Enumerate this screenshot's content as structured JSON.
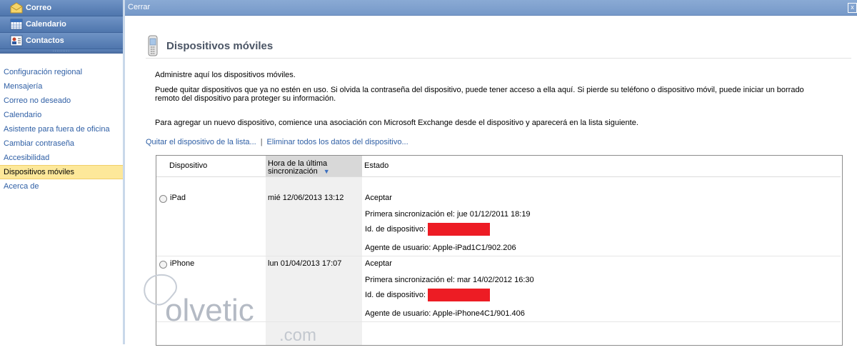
{
  "nav": {
    "mail": "Correo",
    "calendar": "Calendario",
    "contacts": "Contactos"
  },
  "options": {
    "items": [
      "Configuración regional",
      "Mensajería",
      "Correo no deseado",
      "Calendario",
      "Asistente para fuera de oficina",
      "Cambiar contraseña",
      "Accesibilidad",
      "Dispositivos móviles",
      "Acerca de"
    ],
    "selected_index": 7
  },
  "topbar": {
    "close": "Cerrar",
    "x": "x"
  },
  "page": {
    "title": "Dispositivos móviles",
    "p1": "Administre aquí los dispositivos móviles.",
    "p2": "Puede quitar dispositivos que ya no estén en uso. Si olvida la contraseña del dispositivo, puede tener acceso a ella aquí. Si pierde su teléfono o dispositivo móvil, puede iniciar un borrado remoto del dispositivo para proteger su información.",
    "p3": "Para agregar un nuevo dispositivo, comience una asociación con Microsoft Exchange desde el dispositivo y aparecerá en la lista siguiente.",
    "link_remove": "Quitar el dispositivo de la lista...",
    "link_sep": "|",
    "link_wipe": "Eliminar todos los datos del dispositivo..."
  },
  "table": {
    "headers": {
      "device": "Dispositivo",
      "last_sync_1": "Hora de la última",
      "last_sync_2": "sincronización",
      "sort_icon": "▼",
      "status": "Estado"
    },
    "rows": [
      {
        "device": "iPad",
        "last_sync": "mié 12/06/2013 13:12",
        "status": "Aceptar",
        "first_sync": "Primera sincronización el: jue 01/12/2011 18:19",
        "device_id": "Id. de dispositivo:",
        "user_agent": "Agente de usuario: Apple-iPad1C1/902.206"
      },
      {
        "device": "iPhone",
        "last_sync": "lun 01/04/2013 17:07",
        "status": "Aceptar",
        "first_sync": "Primera sincronización el: mar 14/02/2012 16:30",
        "device_id": "Id. de dispositivo:",
        "user_agent": "Agente de usuario: Apple-iPhone4C1/901.406"
      }
    ]
  },
  "watermark": {
    "brand": "olvetic",
    "suffix": ".com"
  },
  "colors": {
    "link": "#2f5fa5",
    "selected": "#fde89a",
    "redaction": "#ed1c24"
  }
}
